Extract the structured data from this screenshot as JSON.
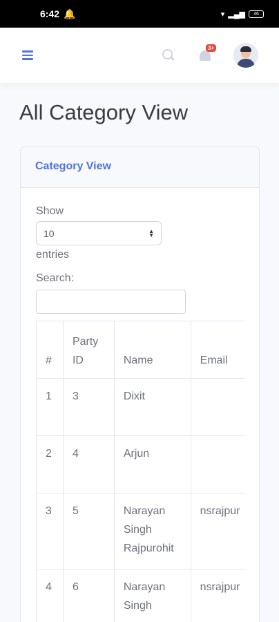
{
  "status_bar": {
    "time": "6:42",
    "battery": "46"
  },
  "topbar": {
    "notification_count": "3+"
  },
  "page": {
    "title": "All Category View"
  },
  "card": {
    "header": "Category View",
    "show_label": "Show",
    "entries_select_value": "10",
    "entries_label": "entries",
    "search_label": "Search:",
    "search_value": ""
  },
  "table": {
    "headers": [
      "#",
      "Party ID",
      "Name",
      "Email"
    ],
    "rows": [
      {
        "num": "1",
        "party_id": "3",
        "name": "Dixit",
        "email": ""
      },
      {
        "num": "2",
        "party_id": "4",
        "name": "Arjun",
        "email": ""
      },
      {
        "num": "3",
        "party_id": "5",
        "name": "Narayan Singh Rajpurohit",
        "email": "nsrajpur"
      },
      {
        "num": "4",
        "party_id": "6",
        "name": "Narayan Singh",
        "email": "nsrajpur"
      }
    ]
  },
  "colors": {
    "accent": "#4e73df",
    "badge": "#e74a3b",
    "background": "#f8f9fc"
  }
}
